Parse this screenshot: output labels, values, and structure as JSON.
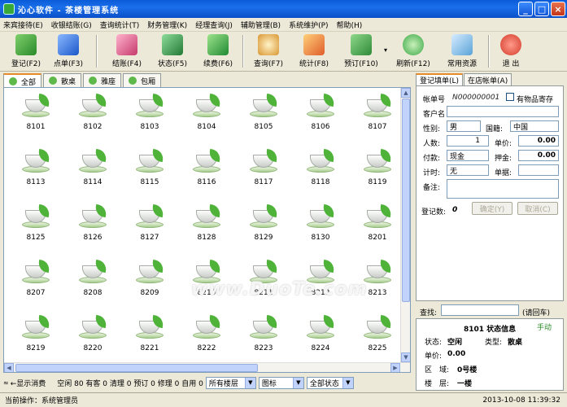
{
  "window": {
    "title": "沁心软件 - 茶楼管理系统"
  },
  "menu": [
    "来宾接待(E)",
    "收银结账(G)",
    "查询统计(T)",
    "财务管理(K)",
    "经理查询(J)",
    "辅助管理(B)",
    "系统维护(P)",
    "帮助(H)"
  ],
  "toolbar": [
    {
      "label": "登记(F2)",
      "icon": "register-icon",
      "color": "#3a8d2f"
    },
    {
      "label": "点单(F3)",
      "icon": "order-icon",
      "color": "#2b6bd3"
    },
    {
      "label": "结账(F4)",
      "icon": "checkout-icon",
      "color": "#d94b7a"
    },
    {
      "label": "状态(F5)",
      "icon": "status-icon",
      "color": "#2f8f44"
    },
    {
      "label": "续费(F6)",
      "icon": "renew-icon",
      "color": "#2fa84a"
    },
    {
      "label": "查询(F7)",
      "icon": "search-icon",
      "color": "#d9952f"
    },
    {
      "label": "统计(F8)",
      "icon": "stats-icon",
      "color": "#e05d2a"
    },
    {
      "label": "预订(F10)",
      "icon": "reserve-icon",
      "color": "#2e8a38"
    },
    {
      "label": "刷新(F12)",
      "icon": "refresh-icon",
      "color": "#3aa845"
    },
    {
      "label": "常用资源",
      "icon": "resources-icon",
      "color": "#5aa3d8"
    },
    {
      "label": "退 出",
      "icon": "exit-icon",
      "color": "#d43a2a"
    }
  ],
  "tabs": [
    "全部",
    "散桌",
    "雅座",
    "包厢"
  ],
  "rooms": [
    "8101",
    "8102",
    "8103",
    "8104",
    "8105",
    "8106",
    "8107",
    "8113",
    "8114",
    "8115",
    "8116",
    "8117",
    "8118",
    "8119",
    "8125",
    "8126",
    "8127",
    "8128",
    "8129",
    "8130",
    "8201",
    "8207",
    "8208",
    "8209",
    "8210",
    "8211",
    "8212",
    "8213",
    "8219",
    "8220",
    "8221",
    "8222",
    "8223",
    "8224",
    "8225"
  ],
  "status_bar": {
    "toggle_label": "←显示消费",
    "counts": "空闲 80 有客 0 清理 0 预订 0 修理 0 自用 0",
    "floor_select": "所有楼层",
    "view_select": "图标",
    "state_select": "全部状态",
    "operator": "当前操作：系统管理员",
    "datetime": "2013-10-08 11:39:32"
  },
  "right_tabs": [
    "登记填单(L)",
    "在店帐单(A)"
  ],
  "form": {
    "bill_no_label": "帐单号",
    "bill_no": "N000000001",
    "deposit_label": "有物品寄存",
    "customer_label": "客户名",
    "gender_label": "性别:",
    "gender": "男",
    "nationality_label": "国籍:",
    "nationality": "中国",
    "people_label": "人数:",
    "people": "1",
    "price_label": "单价:",
    "price": "0.00",
    "payment_label": "付款:",
    "payment": "现金",
    "pledge_label": "押金:",
    "pledge": "0.00",
    "timing_label": "计时:",
    "timing": "无",
    "voucher_label": "单据:",
    "remark_label": "备注:",
    "confirm_label": "确定(Y)",
    "cancel_label": "取消(C)",
    "count_label": "登记数:",
    "count": "0"
  },
  "info": {
    "search_label": "查找:",
    "enter_hint": "(请回车)",
    "title": "8101 状态信息",
    "manual": "手动",
    "status_label": "状态:",
    "status": "空闲",
    "type_label": "类型:",
    "type": "散桌",
    "price_label": "单价:",
    "price": "0.00",
    "area_label": "区　域:",
    "area": "0号楼",
    "floor_label": "楼　层:",
    "floor": "一楼"
  },
  "watermark": "www.DuoTe.com"
}
